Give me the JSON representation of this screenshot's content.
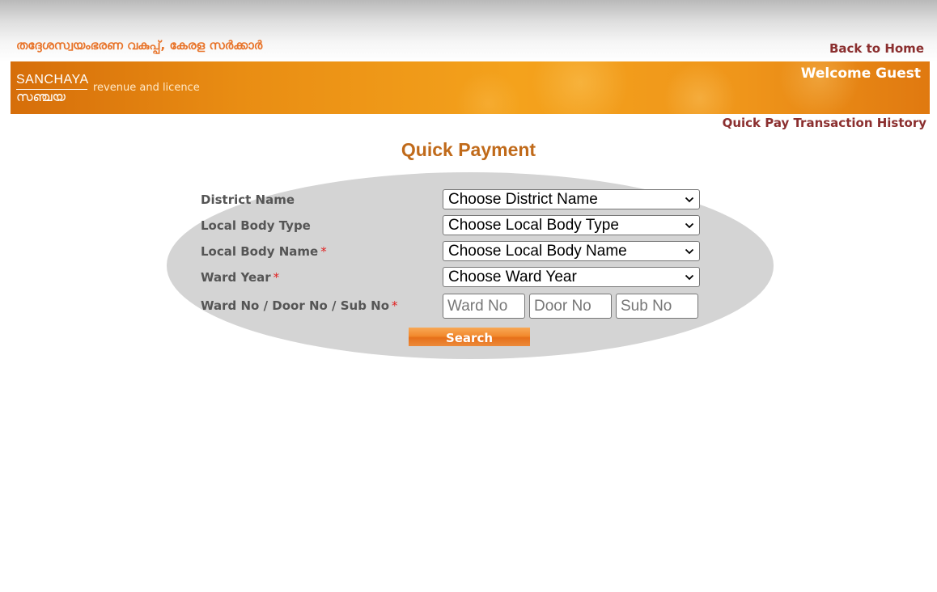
{
  "header": {
    "department_title": "തദ്ദേശസ്വയംഭരണ വകുപ്പ്, കേരള സർക്കാർ",
    "back_home_label": "Back to Home"
  },
  "banner": {
    "logo_text_en": "SANCHAYA",
    "logo_text_ml": "സഞ്ചയ",
    "tagline": "revenue and licence",
    "welcome_text": "Welcome Guest"
  },
  "nav": {
    "history_link": "Quick Pay Transaction History"
  },
  "main": {
    "title": "Quick Payment"
  },
  "form": {
    "district": {
      "label": "District Name",
      "selected": "Choose District Name",
      "required": false
    },
    "local_body_type": {
      "label": "Local Body Type",
      "selected": "Choose Local Body Type",
      "required": false
    },
    "local_body_name": {
      "label": "Local Body Name",
      "selected": "Choose Local Body Name",
      "required": true
    },
    "ward_year": {
      "label": "Ward Year",
      "selected": "Choose Ward Year",
      "required": true
    },
    "numbers": {
      "label": "Ward No / Door No / Sub No",
      "required": true,
      "ward_placeholder": "Ward No",
      "door_placeholder": "Door No",
      "sub_placeholder": "Sub No"
    },
    "required_marker": "*",
    "search_label": "Search"
  },
  "colors": {
    "accent_orange": "#e8742a",
    "link_maroon": "#8b2f2f",
    "title_orange": "#c06a1a",
    "panel_gray": "#d4d4d4",
    "required_red": "#e02020"
  }
}
